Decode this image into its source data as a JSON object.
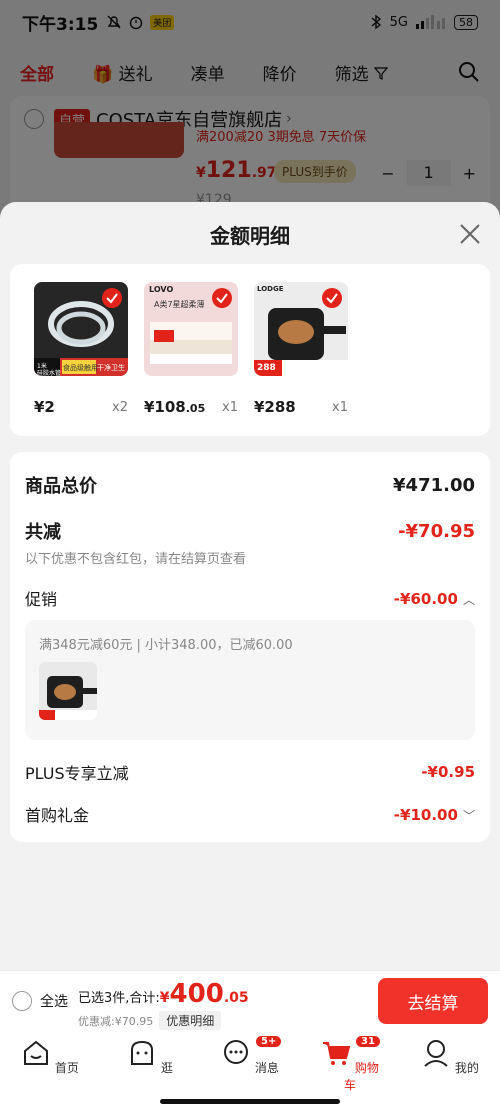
{
  "status_bar": {
    "time": "下午3:15",
    "app_badge": "美团",
    "network": "5G",
    "battery": "58"
  },
  "filter_bar": {
    "items": [
      "全部",
      "送礼",
      "凑单",
      "降价",
      "筛选"
    ]
  },
  "store": {
    "badge": "自营",
    "name": "COSTA京东自营旗舰店",
    "promo": "满200减20  3期免息  7天价保",
    "price_symbol": "¥",
    "price_int": "121",
    "price_dec": ".97",
    "plus_label": "PLUS到手价",
    "qty": "1",
    "old_price": "¥129"
  },
  "sheet": {
    "title": "金额明细",
    "items": [
      {
        "price": "¥2",
        "price_dec": "",
        "qty": "x2"
      },
      {
        "price": "¥108",
        "price_dec": ".05",
        "qty": "x1"
      },
      {
        "price": "¥288",
        "price_dec": "",
        "qty": "x1"
      }
    ],
    "thumb_text": {
      "t1_a": "1米",
      "t1_b": "硅胶水管",
      "t1_c": "食品级触用",
      "t1_d": "干净卫生",
      "t2_a": "LOVO",
      "t2_b": "A类7星超柔薄",
      "t3_a": "LODGE",
      "t3_b": "288"
    },
    "summary": {
      "total_label": "商品总价",
      "total_value": "¥471.00",
      "reduce_label": "共减",
      "reduce_value": "-¥70.95",
      "reduce_note": "以下优惠不包含红包，请在结算页查看",
      "promo_label": "促销",
      "promo_value": "-¥60.00",
      "promo_detail": "满348元减60元 | 小计348.00，已减60.00",
      "plus_label": "PLUS专享立减",
      "plus_value": "-¥0.95",
      "first_label": "首购礼金",
      "first_value": "-¥10.00"
    }
  },
  "checkout": {
    "select_all": "全选",
    "selected_text": "已选3件,合计:",
    "total_symbol": "¥",
    "total_int": "400",
    "total_dec": ".05",
    "discount": "优惠减:¥70.95",
    "detail": "优惠明细",
    "button": "去结算"
  },
  "tabbar": {
    "items": [
      {
        "label": "首页"
      },
      {
        "label": "逛"
      },
      {
        "label": "消息",
        "badge": "5+"
      },
      {
        "label": "购物车",
        "badge": "31"
      },
      {
        "label": "我的"
      }
    ]
  },
  "colors": {
    "accent": "#e2231a",
    "button": "#f0322b"
  }
}
